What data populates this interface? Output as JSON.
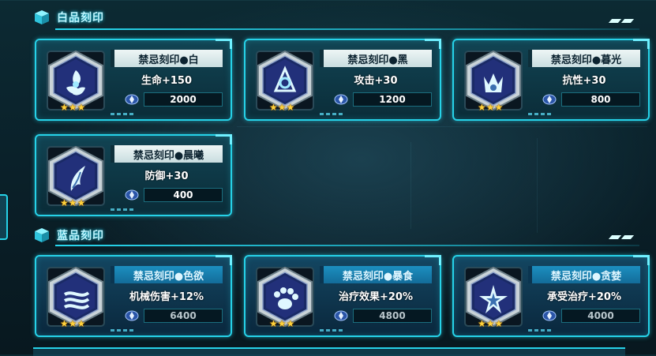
{
  "colors": {
    "accent": "#26d2e8",
    "star": "#ffd23b",
    "white_name_bg": "#e6f1f2",
    "blue_name_bg": "#1c8fc0"
  },
  "sections": [
    {
      "title": "白品刻印",
      "cards": [
        {
          "name": "禁忌刻印●白",
          "stat": "生命+150",
          "cost": "2000",
          "stars": 3,
          "icon": "triskelion-sigil-icon"
        },
        {
          "name": "禁忌刻印●黑",
          "stat": "攻击+30",
          "cost": "1200",
          "stars": 3,
          "icon": "tri-spiral-sigil-icon"
        },
        {
          "name": "禁忌刻印●暮光",
          "stat": "抗性+30",
          "cost": "800",
          "stars": 3,
          "icon": "crown-flame-sigil-icon"
        },
        {
          "name": "禁忌刻印●晨曦",
          "stat": "防御+30",
          "cost": "400",
          "stars": 3,
          "icon": "wing-feather-sigil-icon"
        }
      ]
    },
    {
      "title": "蓝品刻印",
      "cards": [
        {
          "name": "禁忌刻印●色欲",
          "stat": "机械伤害+12%",
          "cost": "6400",
          "stars": 3,
          "icon": "wind-wave-sigil-icon"
        },
        {
          "name": "禁忌刻印●暴食",
          "stat": "治疗效果+20%",
          "cost": "4800",
          "stars": 3,
          "icon": "paw-print-sigil-icon"
        },
        {
          "name": "禁忌刻印●贪婪",
          "stat": "承受治疗+20%",
          "cost": "4000",
          "stars": 3,
          "icon": "star-burst-sigil-icon"
        }
      ]
    }
  ],
  "currency_icon": "crystal-coin-icon"
}
